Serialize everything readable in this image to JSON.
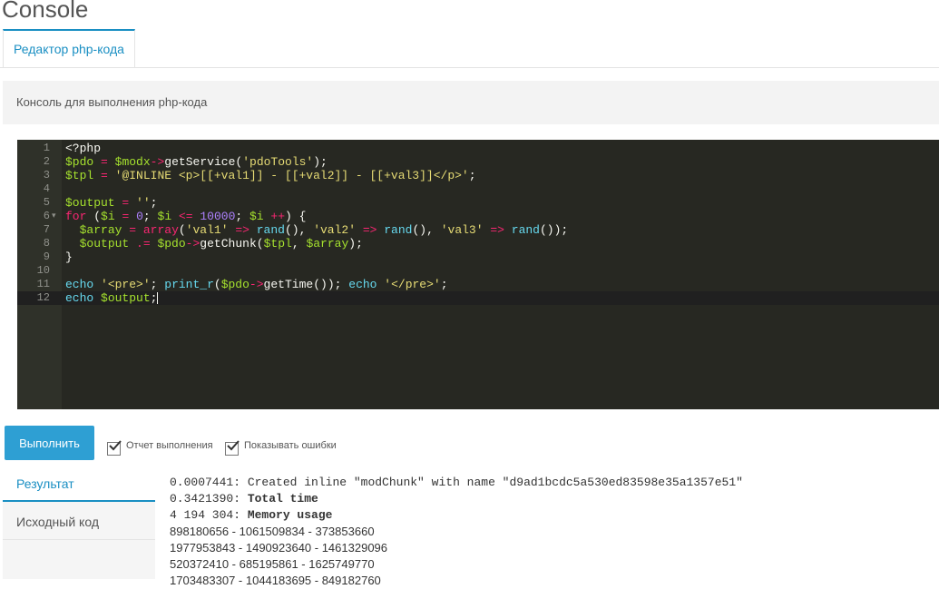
{
  "page": {
    "title": "Console"
  },
  "tabs": [
    {
      "label": "Редактор php-кода",
      "active": true
    }
  ],
  "description": "Консоль для выполнения php-кода",
  "editor": {
    "lines": [
      {
        "n": "1",
        "text": "<?php"
      },
      {
        "n": "2",
        "text": "$pdo = $modx->getService('pdoTools');"
      },
      {
        "n": "3",
        "text": "$tpl = '@INLINE <p>[[+val1]] - [[+val2]] - [[+val3]]</p>';"
      },
      {
        "n": "4",
        "text": ""
      },
      {
        "n": "5",
        "text": "$output = '';"
      },
      {
        "n": "6",
        "text": "for ($i = 0; $i <= 10000; $i ++) {"
      },
      {
        "n": "7",
        "text": "  $array = array('val1' => rand(), 'val2' => rand(), 'val3' => rand());"
      },
      {
        "n": "8",
        "text": "  $output .= $pdo->getChunk($tpl, $array);"
      },
      {
        "n": "9",
        "text": "}"
      },
      {
        "n": "10",
        "text": ""
      },
      {
        "n": "11",
        "text": "echo '<pre>'; print_r($pdo->getTime()); echo '</pre>';"
      },
      {
        "n": "12",
        "text": "echo $output;"
      }
    ],
    "active_line": "12",
    "theme_colors": {
      "background": "#272822",
      "gutter": "#2f3129",
      "variable": "#a6e22e",
      "operator": "#f92672",
      "string": "#e6db74",
      "function": "#66d9ef",
      "number": "#ae81ff"
    }
  },
  "actions": {
    "run_label": "Выполнить",
    "checkbox_report": {
      "label": "Отчет выполнения",
      "checked": true
    },
    "checkbox_errors": {
      "label": "Показывать ошибки",
      "checked": true
    }
  },
  "result_tabs": [
    {
      "label": "Результат",
      "active": true
    },
    {
      "label": "Исходный код",
      "active": false
    }
  ],
  "result": {
    "log": [
      {
        "time": "0.0007441:",
        "msg": "Created inline \"modChunk\" with name \"d9ad1bcdc5a530ed83598e35a1357e51\"",
        "bold": false
      },
      {
        "time": "0.3421390:",
        "msg": "Total time",
        "bold": true
      },
      {
        "time": "4 194 304:",
        "msg": "Memory usage",
        "bold": true
      }
    ],
    "output_lines": [
      "898180656 - 1061509834 - 373853660",
      "1977953843 - 1490923640 - 1461329096",
      "520372410 - 685195861 - 1625749770",
      "1703483307 - 1044183695 - 849182760"
    ]
  },
  "colors": {
    "accent": "#1a8fc3",
    "button": "#2e9fd3"
  }
}
